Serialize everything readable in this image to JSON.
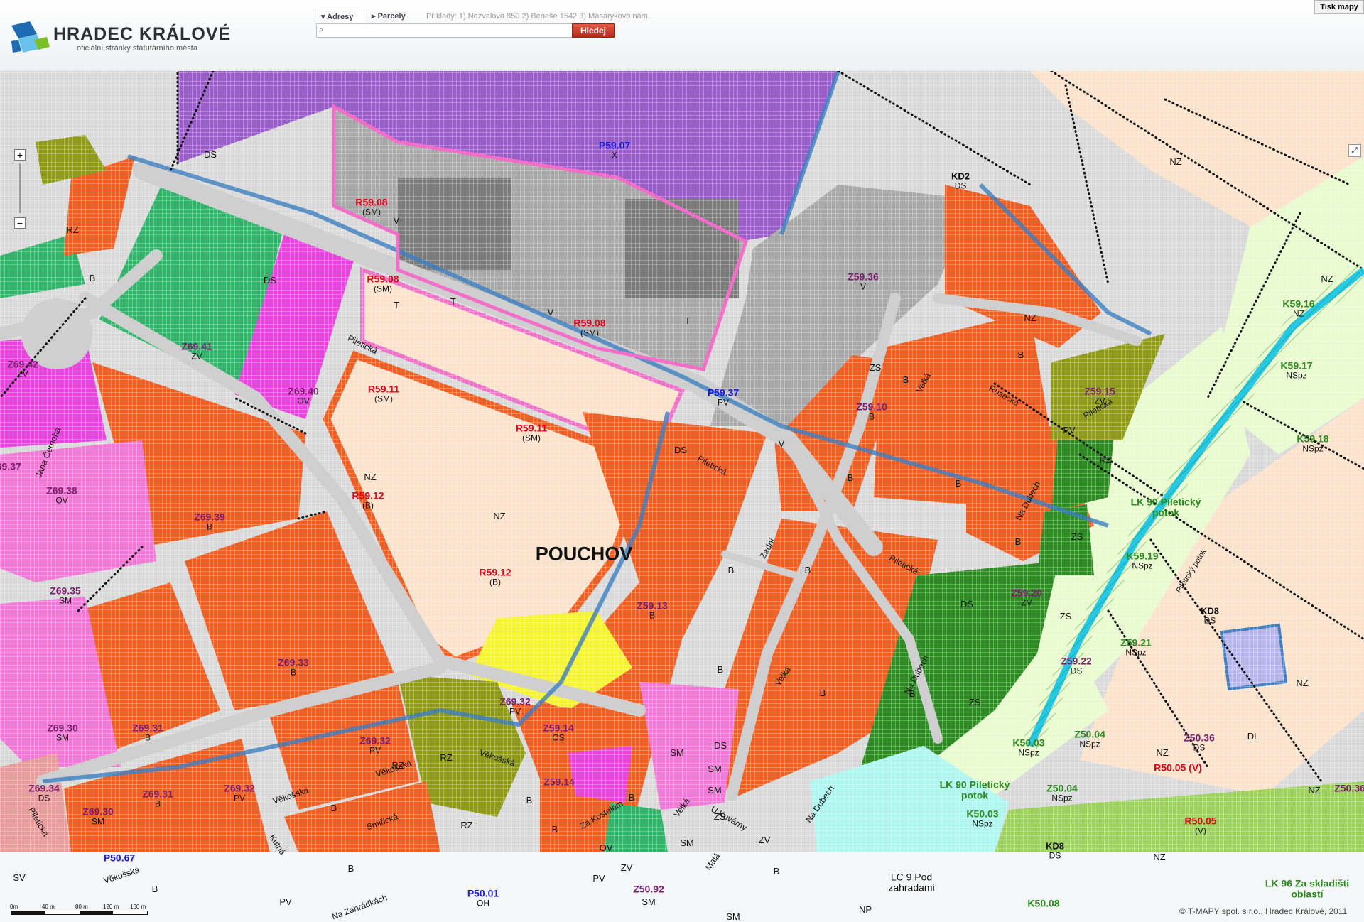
{
  "header": {
    "city_name": "HRADEC KRÁLOVÉ",
    "city_subtitle": "oficiální stránky statutárního města",
    "search": {
      "tab_adresy": "Adresy",
      "tab_parcely": "Parcely",
      "examples": "Příklady: 1) Nezvalova 850   2) Beneše 1542   3) Masarykovo nám.",
      "input_value": "",
      "input_placeholder": "",
      "button_label": "Hledej"
    },
    "print_label": "Tisk mapy"
  },
  "map": {
    "place_name": "POUCHOV",
    "colors": {
      "residential_B": "#f95a1d",
      "mixed_SM": "#f576d6",
      "services_OV": "#ee3fe1",
      "greenery_ZV": "#2fb569",
      "greenery_ZS": "#2a8c1f",
      "recreation_RZ": "#8e9a12",
      "industry_V": "#a9a9a9",
      "undeveloped_NZ": "#fde2cb",
      "transport_DS": "#d6d6d6",
      "civic_purple": "#9b5ccb",
      "sport_OS": "#f5f528",
      "nature_NSpz": "#e8fbcf",
      "biocorridor_LK": "#aef7f0",
      "rail_DL": "#b7b5ee",
      "boundary_blue": "#3d7fc2",
      "boundary_pink": "#f36ec8"
    },
    "labels": {
      "p5907": "P59.07",
      "x": "X",
      "ds_top": "DS",
      "kd2": "KD2",
      "kd2_ds": "DS",
      "nz_tr": "NZ",
      "r5908a": "R59.08",
      "r5908a_sub": "(SM)",
      "v_a": "V",
      "r5908b": "R59.08",
      "r5908b_sub": "(SM)",
      "t_a": "T",
      "t_b": "T",
      "v_b": "V",
      "r5908c": "R59.08",
      "r5908c_sub": "(SM)",
      "t_c": "T",
      "z5936": "Z59.36",
      "z5936_sub": "V",
      "rz_tl": "RZ",
      "b_tl": "B",
      "ds_l": "DS",
      "z6941": "Z69.41",
      "z6941_sub": "ZV",
      "z6942": "Z69.42",
      "z6942_sub": "ZV",
      "z6940": "Z69.40",
      "z6940_sub": "OV",
      "r5911a": "R59.11",
      "r5911a_sub": "(SM)",
      "r5911b": "R59.11",
      "r5911b_sub": "(SM)",
      "p5937": "P59.37",
      "p5937_sub": "PV",
      "v_c": "V",
      "zs_a": "ZS",
      "b_a": "B",
      "z5910": "Z59.10",
      "z5910_sub": "B",
      "b_b": "B",
      "nz_b": "NZ",
      "z5915": "Z59.15",
      "z5915_sub": "ZV",
      "pv_a": "PV",
      "rz_r": "RZ",
      "k5916": "K59.16",
      "k5916_sub": "NZ",
      "nz_c": "NZ",
      "k5917": "K59.17",
      "k5917_sub": "NSpz",
      "k5918": "K59.18",
      "k5918_sub": "NSpz",
      "nz_pouchov": "NZ",
      "r5912a": "R59.12",
      "r5912a_sub": "(B)",
      "nz_mid": "NZ",
      "r5912b": "R59.12",
      "r5912b_sub": "(B)",
      "z6938": "Z69.38",
      "z6938_sub": "OV",
      "z6939": "Z69.39",
      "z6939_sub": "B",
      "ds_mid": "DS",
      "b_c": "B",
      "b_d": "B",
      "b_e": "B",
      "zs_b": "ZS",
      "b_f": "B",
      "lk90a": "LK 90 Piletický",
      "lk90a2": "potok",
      "k5919": "K59.19",
      "k5919_sub": "NSpz",
      "z5920": "Z59.20",
      "z5920_sub": "ZV",
      "zs_c": "ZS",
      "ds_r": "DS",
      "kd8": "KD8",
      "kd8_sub": "DS",
      "z5921": "Z59.21",
      "z5921_sub": "NSpz",
      "z6935": "Z69.35",
      "z6935_sub": "SM",
      "z5913": "Z59.13",
      "z5913_sub": "B",
      "b_g": "B",
      "z6933": "Z69.33",
      "z6933_sub": "B",
      "b_h": "B",
      "b_i": "B",
      "zs_d": "ZS",
      "z5922": "Z59.22",
      "z5922_sub": "DS",
      "nz_r2": "NZ",
      "dl": "DL",
      "z6932a": "Z69.32",
      "z6932a_sub": "PV",
      "z5914": "Z59.14",
      "z5914_sub": "OS",
      "z6930a": "Z69.30",
      "z6930a_sub": "SM",
      "z6931a": "Z69.31",
      "z6931a_sub": "B",
      "z6932b": "Z69.32",
      "z6932b_sub": "PV",
      "rz_b": "RZ",
      "rz_b2": "RZ",
      "ds_b": "DS",
      "k5003a": "K50.03",
      "k5003a_sub": "NSpz",
      "z5004a": "Z50.04",
      "z5004a_sub": "NSpz",
      "z5036": "Z50.36",
      "z5036_sub": "DS",
      "nz_d": "NZ",
      "r5005a": "R50.05 (V)",
      "nz_e": "NZ",
      "z6934": "Z69.34",
      "z6934_sub": "DS",
      "z6930b": "Z69.30",
      "z6930b_sub": "SM",
      "z6931b": "Z69.31",
      "z6931b_sub": "B",
      "z6932c": "Z69.32",
      "z6932c_sub": "PV",
      "b_j": "B",
      "b_k": "B",
      "rz_c": "RZ",
      "b_l": "B",
      "b_m": "B",
      "sm_a": "SM",
      "sm_b": "SM",
      "sm_c": "SM",
      "sm_d": "SM",
      "ds_c": "DS",
      "z5914b": "Z59.14",
      "zv_a": "ZV",
      "zs_e": "ZS",
      "lk90b": "LK 90 Piletický",
      "lk90b2": "potok",
      "z5004b": "Z50.04",
      "z5004b_sub": "NSpz",
      "k5003b": "K50.03",
      "k5003b_sub": "NSpz",
      "r5005b": "R50.05",
      "r5005b_sub": "(V)",
      "kd8b": "KD8",
      "kd8b_sub": "DS",
      "nz_f": "NZ",
      "sv": "SV",
      "p5067": "P50.67",
      "b_n": "B",
      "b_o": "B",
      "b_p": "B",
      "pv_b": "PV",
      "ov_a": "OV",
      "zv_b": "ZV",
      "pv_c": "PV",
      "z5092": "Z50.92",
      "sm_e": "SM",
      "sm_f": "SM",
      "b_q": "B",
      "p5001": "P50.01",
      "p5001_sub": "OH",
      "lc9": "LC 9 Pod",
      "lc9b": "zahradami",
      "np": "NP",
      "k5008": "K50.08",
      "lk96": "LK 96 Za skladišti",
      "lk96b": "oblastí",
      "z5036b": "Z50.36",
      "z6937": "Z69.37"
    },
    "streets": {
      "piletickaA": "Piletická",
      "piletickaB": "Piletická",
      "piletickaC": "Piletická",
      "piletickaD": "Piletická",
      "piletickyPotok": "Piletický potok",
      "ruseckaA": "Rusecká",
      "velkaA": "Velká",
      "velkaB": "Velká",
      "velkaC": "Velká",
      "zadni": "Zadní",
      "naDubechA": "Na Dubech",
      "naDubechB": "Na Dubech",
      "naDubechC": "Na Dubech",
      "janaCernoha": "Jana Černoha",
      "vekosskaA": "Věkošská",
      "vekosskaB": "Věkošská",
      "vekosskaC": "Věkošská",
      "vekosskaD": "Věkošská",
      "kutnaA": "Kutná",
      "smirickaA": "Smiřická",
      "zaKostelem": "Za Kostelem",
      "uKovarny": "U Kovárny",
      "mala": "Malá",
      "zahradkach": "Na Zahrádkách",
      "piletickaE": "Piletická"
    },
    "scale_labels": [
      "0m",
      "40 m",
      "80 m",
      "120 m",
      "160 m"
    ],
    "copyright": "© T-MAPY spol. s r.o., Hradec Králové, 2011"
  }
}
